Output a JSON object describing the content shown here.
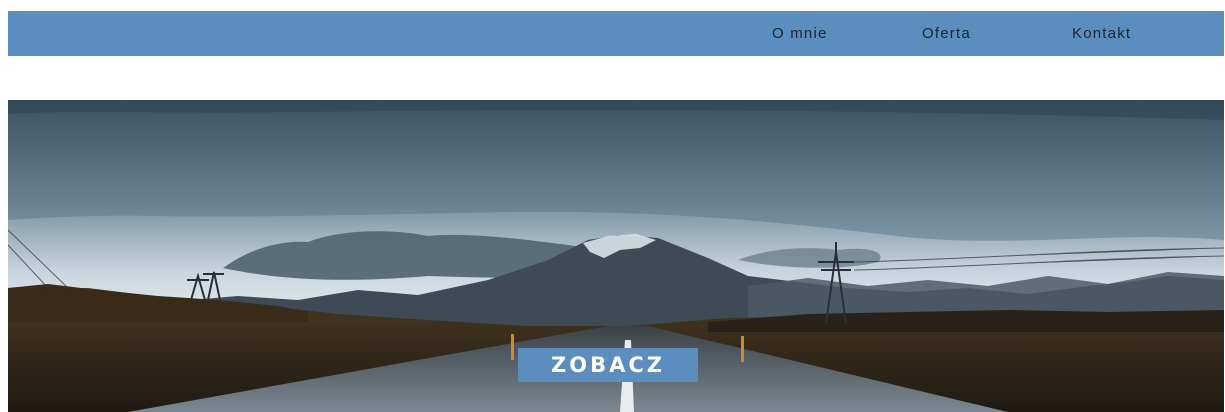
{
  "nav": {
    "items": [
      {
        "label": "O mnie"
      },
      {
        "label": "Oferta"
      },
      {
        "label": "Kontakt"
      }
    ]
  },
  "hero": {
    "button_label": "ZOBACZ",
    "image_subject": "road-mountain-landscape"
  },
  "colors": {
    "accent": "#5b8ebf",
    "nav_text": "#1c2530",
    "button_text": "#ffffff"
  }
}
